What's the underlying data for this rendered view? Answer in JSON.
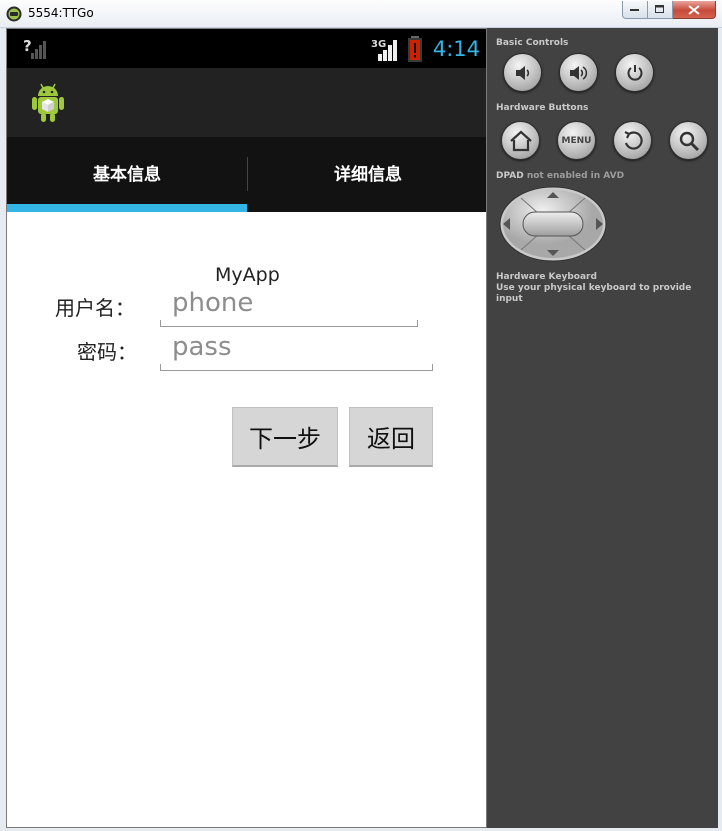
{
  "window": {
    "title": "5554:TTGo"
  },
  "statusbar": {
    "network": "3G",
    "time": "4:14",
    "colors": {
      "time": "#33b5e5",
      "battery_warning": "#cc2200"
    }
  },
  "actionbar": {
    "icon": "android-app-icon"
  },
  "tabs": [
    {
      "label": "基本信息",
      "selected": true
    },
    {
      "label": "详细信息",
      "selected": false
    }
  ],
  "form": {
    "app_label": "MyApp",
    "username_label": "用户名：",
    "username_placeholder": "phone",
    "password_label": "密码：",
    "password_placeholder": "pass",
    "next_button": "下一步",
    "back_button": "返回"
  },
  "controls": {
    "basic_controls": "Basic Controls",
    "hardware_buttons": "Hardware Buttons",
    "menu_label": "MENU",
    "dpad_title": "DPAD",
    "dpad_note": "not enabled in AVD",
    "keyboard_title": "Hardware Keyboard",
    "keyboard_note": "Use your physical keyboard to provide input",
    "basic_icons": [
      "volume-down-icon",
      "volume-up-icon",
      "power-icon"
    ],
    "hardware_icons": [
      "home-icon",
      "menu-icon",
      "back-icon",
      "search-icon"
    ]
  },
  "accent": "#33b5e5"
}
